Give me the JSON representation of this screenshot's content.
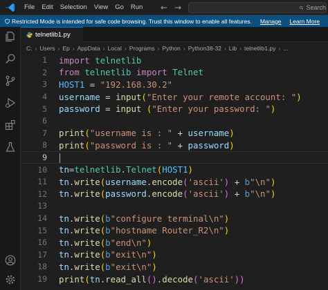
{
  "menu": [
    "File",
    "Edit",
    "Selection",
    "View",
    "Go",
    "Run"
  ],
  "search": {
    "label": "Search"
  },
  "banner": {
    "message": "Restricted Mode is intended for safe code browsing. Trust this window to enable all features.",
    "manage": "Manage",
    "learn_more": "Learn More"
  },
  "tab": {
    "label": "telnetlib1.py"
  },
  "breadcrumb": [
    "C:",
    "Users",
    "Ep",
    "AppData",
    "Local",
    "Programs",
    "Python",
    "Python38-32",
    "Lib",
    "telnetlib1.py",
    "..."
  ],
  "editor": {
    "current_line": 9,
    "lines": [
      [
        [
          "kw",
          "import"
        ],
        [
          "def",
          " "
        ],
        [
          "mod",
          "telnetlib"
        ]
      ],
      [
        [
          "kw",
          "from"
        ],
        [
          "def",
          " "
        ],
        [
          "mod",
          "telnetlib"
        ],
        [
          "def",
          " "
        ],
        [
          "kw",
          "import"
        ],
        [
          "def",
          " "
        ],
        [
          "mod",
          "Telnet"
        ]
      ],
      [
        [
          "const",
          "HOST1"
        ],
        [
          "def",
          " = "
        ],
        [
          "str",
          "\"192.168.30.2\""
        ]
      ],
      [
        [
          "var",
          "username"
        ],
        [
          "def",
          " = "
        ],
        [
          "fn",
          "input"
        ],
        [
          "pn",
          "("
        ],
        [
          "str",
          "\"Enter your remote account: \""
        ],
        [
          "pn",
          ")"
        ]
      ],
      [
        [
          "var",
          "password"
        ],
        [
          "def",
          " = "
        ],
        [
          "fn",
          "input"
        ],
        [
          "def",
          " "
        ],
        [
          "pn",
          "("
        ],
        [
          "str",
          "\"Enter your password: \""
        ],
        [
          "pn",
          ")"
        ]
      ],
      [],
      [
        [
          "fn",
          "print"
        ],
        [
          "pn",
          "("
        ],
        [
          "str",
          "\"username is : \""
        ],
        [
          "def",
          " + "
        ],
        [
          "var",
          "username"
        ],
        [
          "pn",
          ")"
        ]
      ],
      [
        [
          "fn",
          "print"
        ],
        [
          "pn",
          "("
        ],
        [
          "str",
          "\"password is : \""
        ],
        [
          "def",
          " + "
        ],
        [
          "var",
          "password"
        ],
        [
          "pn",
          ")"
        ]
      ],
      [],
      [
        [
          "var",
          "tn"
        ],
        [
          "def",
          "="
        ],
        [
          "mod",
          "telnetlib"
        ],
        [
          "def",
          "."
        ],
        [
          "mod",
          "Telnet"
        ],
        [
          "pn",
          "("
        ],
        [
          "const",
          "HOST1"
        ],
        [
          "pn",
          ")"
        ]
      ],
      [
        [
          "var",
          "tn"
        ],
        [
          "def",
          "."
        ],
        [
          "fn",
          "write"
        ],
        [
          "pn",
          "("
        ],
        [
          "var",
          "username"
        ],
        [
          "def",
          "."
        ],
        [
          "fn",
          "encode"
        ],
        [
          "pn2",
          "("
        ],
        [
          "str",
          "'ascii'"
        ],
        [
          "pn2",
          ")"
        ],
        [
          "def",
          " + "
        ],
        [
          "b",
          "b"
        ],
        [
          "str",
          "\"\\n\""
        ],
        [
          "pn",
          ")"
        ]
      ],
      [
        [
          "var",
          "tn"
        ],
        [
          "def",
          "."
        ],
        [
          "fn",
          "write"
        ],
        [
          "pn",
          "("
        ],
        [
          "var",
          "password"
        ],
        [
          "def",
          "."
        ],
        [
          "fn",
          "encode"
        ],
        [
          "pn2",
          "("
        ],
        [
          "str",
          "'ascii'"
        ],
        [
          "pn2",
          ")"
        ],
        [
          "def",
          " + "
        ],
        [
          "b",
          "b"
        ],
        [
          "str",
          "\"\\n\""
        ],
        [
          "pn",
          ")"
        ]
      ],
      [],
      [
        [
          "var",
          "tn"
        ],
        [
          "def",
          "."
        ],
        [
          "fn",
          "write"
        ],
        [
          "pn",
          "("
        ],
        [
          "b",
          "b"
        ],
        [
          "str",
          "\"configure terminal\\n\""
        ],
        [
          "pn",
          ")"
        ]
      ],
      [
        [
          "var",
          "tn"
        ],
        [
          "def",
          "."
        ],
        [
          "fn",
          "write"
        ],
        [
          "pn",
          "("
        ],
        [
          "b",
          "b"
        ],
        [
          "str",
          "\"hostname Router_R2\\n\""
        ],
        [
          "pn",
          ")"
        ]
      ],
      [
        [
          "var",
          "tn"
        ],
        [
          "def",
          "."
        ],
        [
          "fn",
          "write"
        ],
        [
          "pn",
          "("
        ],
        [
          "b",
          "b"
        ],
        [
          "str",
          "\"end\\n\""
        ],
        [
          "pn",
          ")"
        ]
      ],
      [
        [
          "var",
          "tn"
        ],
        [
          "def",
          "."
        ],
        [
          "fn",
          "write"
        ],
        [
          "pn",
          "("
        ],
        [
          "b",
          "b"
        ],
        [
          "str",
          "\"exit\\n\""
        ],
        [
          "pn",
          ")"
        ]
      ],
      [
        [
          "var",
          "tn"
        ],
        [
          "def",
          "."
        ],
        [
          "fn",
          "write"
        ],
        [
          "pn",
          "("
        ],
        [
          "b",
          "b"
        ],
        [
          "str",
          "\"exit\\n\""
        ],
        [
          "pn",
          ")"
        ]
      ],
      [
        [
          "fn",
          "print"
        ],
        [
          "pn",
          "("
        ],
        [
          "var",
          "tn"
        ],
        [
          "def",
          "."
        ],
        [
          "fn",
          "read_all"
        ],
        [
          "pn2",
          "()"
        ],
        [
          "def",
          "."
        ],
        [
          "fn",
          "decode"
        ],
        [
          "pn2",
          "("
        ],
        [
          "str",
          "'ascii'"
        ],
        [
          "pn2",
          "))"
        ]
      ]
    ]
  }
}
